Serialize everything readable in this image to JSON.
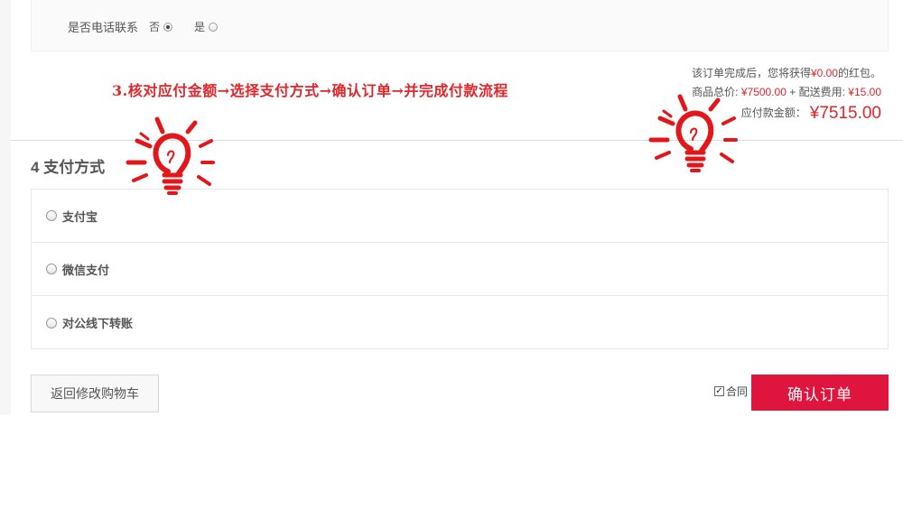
{
  "phone": {
    "label": "是否电话联系",
    "options": [
      {
        "label": "否",
        "checked": true
      },
      {
        "label": "是",
        "checked": false
      }
    ]
  },
  "annotation": "3.核对应付金额→选择支付方式→确认订单→并完成付款流程",
  "summary": {
    "hongbao_prefix": "该订单完成后，您将获得",
    "hongbao_amount": "¥0.00",
    "hongbao_suffix": "的红包。",
    "goods_label": "商品总价:",
    "goods_amount": "¥7500.00",
    "plus": "+",
    "shipping_label": "配送费用:",
    "shipping_amount": "¥15.00",
    "payable_label": "应付款金额：",
    "payable_amount": "¥7515.00"
  },
  "payment": {
    "title": "4 支付方式",
    "methods": [
      {
        "label": "支付宝",
        "checked": false
      },
      {
        "label": "微信支付",
        "checked": false
      },
      {
        "label": "对公线下转账",
        "checked": false
      }
    ]
  },
  "footer": {
    "back_label": "返回修改购物车",
    "contract_label": "合同",
    "contract_checked": true,
    "confirm_label": "确认订单"
  },
  "colors": {
    "accent": "#e0153d",
    "price_red": "#e0262a",
    "annotation_red": "#e0262a"
  },
  "icons": {
    "bulb": "lightbulb-doodle-icon"
  }
}
